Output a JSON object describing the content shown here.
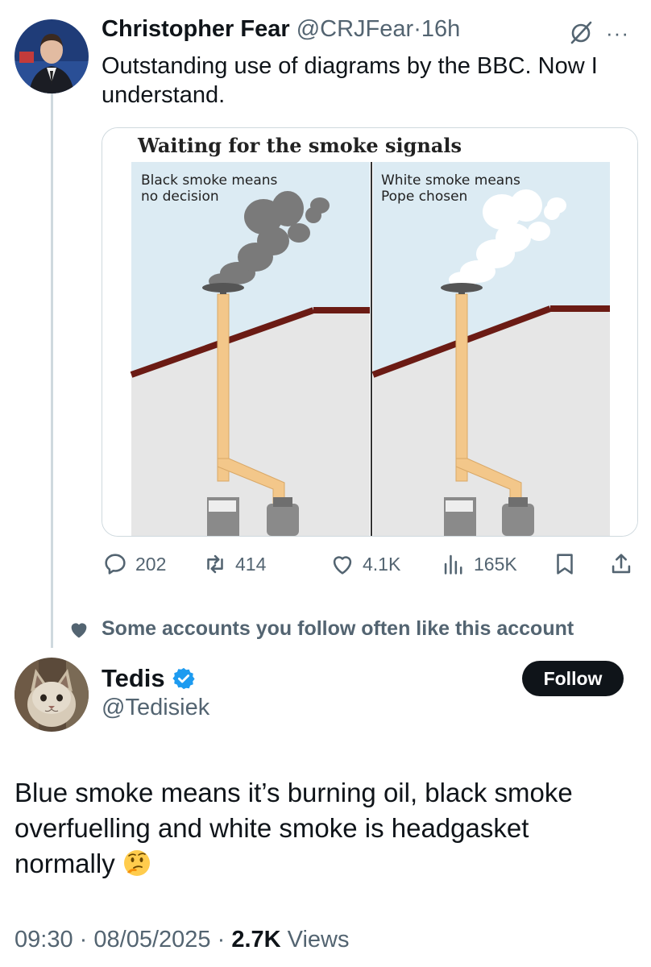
{
  "tweet": {
    "author_name": "Christopher Fear",
    "author_handle": "@CRJFear",
    "separator": "·",
    "time": "16h",
    "more_icon": "more-dots-icon",
    "text": "Outstanding use of diagrams by the BBC. Now I understand.",
    "media": {
      "title": "Waiting for the smoke signals",
      "left_caption_line1": "Black smoke means",
      "left_caption_line2": "no decision",
      "right_caption_line1": "White smoke means",
      "right_caption_line2": "Pope chosen"
    },
    "actions": {
      "replies": "202",
      "reposts": "414",
      "likes": "4.1K",
      "views": "165K"
    }
  },
  "social_context": {
    "icon": "heart-icon",
    "text": "Some accounts you follow often like this account"
  },
  "reply": {
    "author_name": "Tedis",
    "author_handle": "@Tedisiek",
    "verified_icon": "verified-badge-icon",
    "follow_label": "Follow",
    "text": "Blue smoke means it’s burning oil,  black smoke overfuelling and white smoke is headgasket normally",
    "emoji": "thinking-face-emoji",
    "time": "09:30",
    "date": "08/05/2025",
    "separator": "·",
    "views_count": "2.7K",
    "views_label": "Views"
  },
  "colors": {
    "text": "#0f1419",
    "secondary": "#536471",
    "border": "#cfd9de",
    "verified": "#1d9bf0"
  }
}
